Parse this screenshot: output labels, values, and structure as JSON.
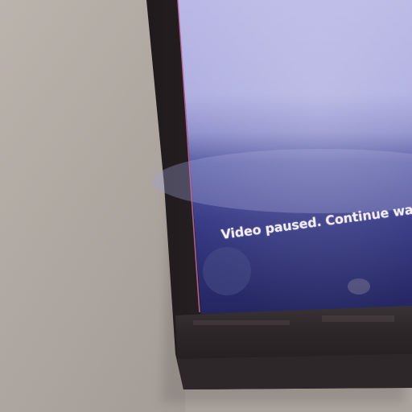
{
  "screen": {
    "message": "Video paused. Continue wa"
  },
  "colors": {
    "wall": "#b4aca5",
    "bezel": "#2a2224",
    "screen_top": "#b7b6e4",
    "screen_bottom": "#2b2c6a"
  }
}
